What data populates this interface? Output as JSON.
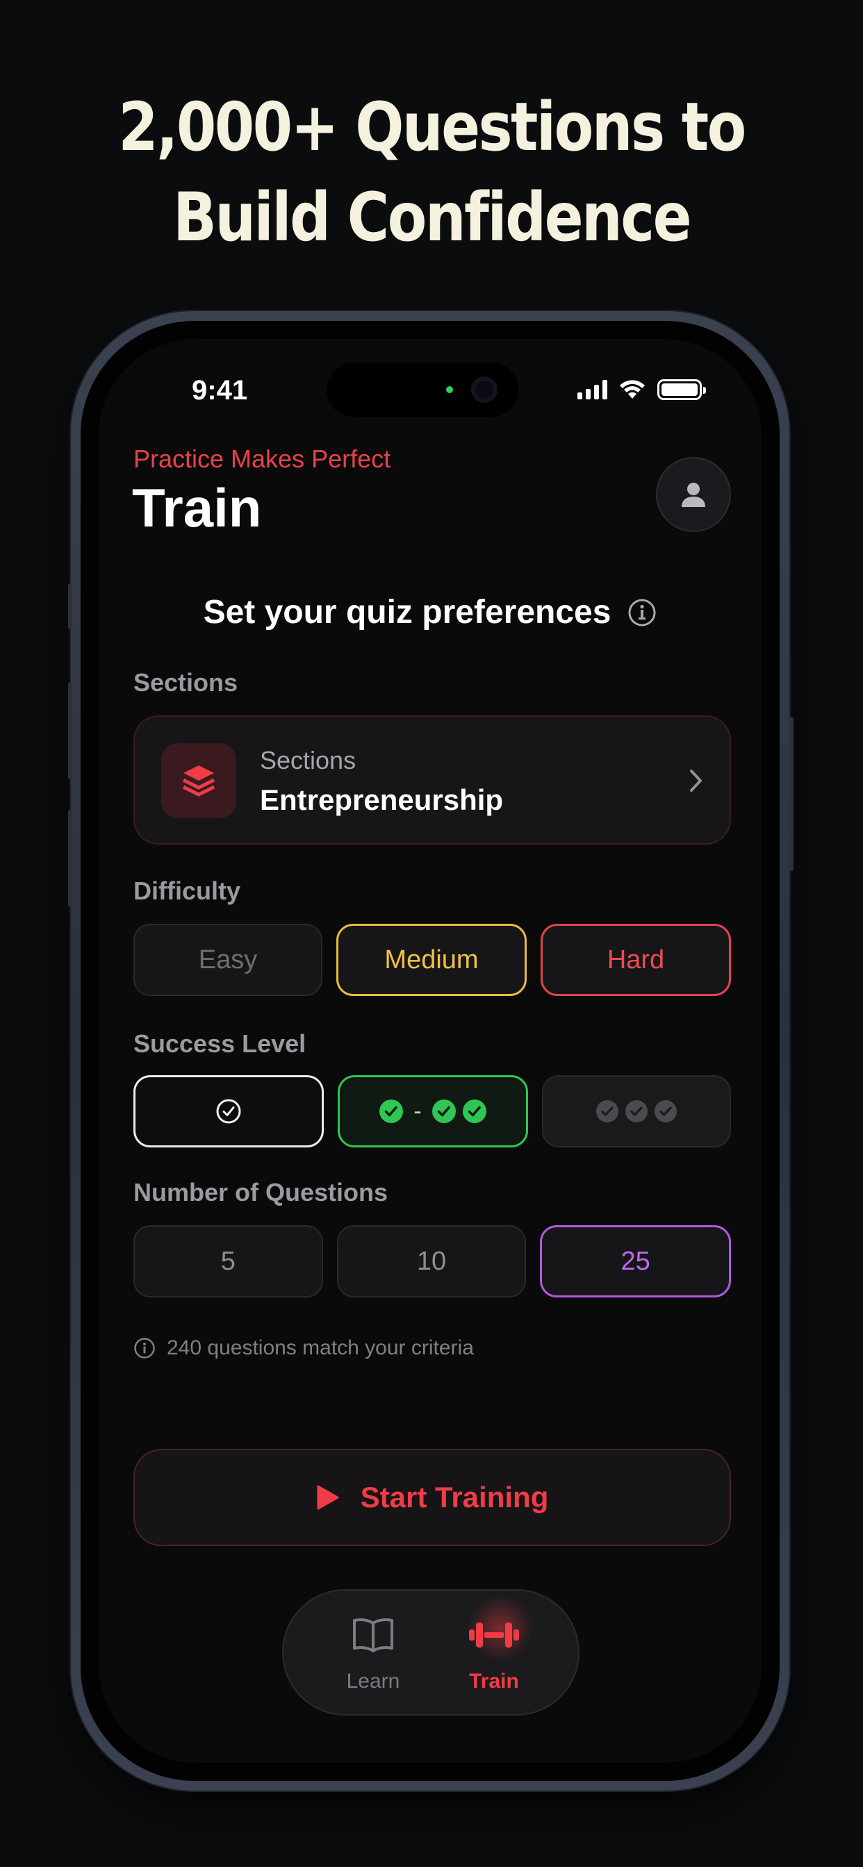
{
  "headline": {
    "line1": "2,000+ Questions to",
    "line2": "Build Confidence"
  },
  "status_bar": {
    "time": "9:41"
  },
  "header": {
    "eyebrow": "Practice Makes Perfect",
    "title": "Train",
    "profile_icon": "person-icon"
  },
  "preferences": {
    "heading": "Set your quiz preferences",
    "info_icon": "info-circle-icon"
  },
  "sections": {
    "label": "Sections",
    "card_subtitle": "Sections",
    "selected": "Entrepreneurship",
    "icon": "layers-icon"
  },
  "difficulty": {
    "label": "Difficulty",
    "options": [
      "Easy",
      "Medium",
      "Hard"
    ],
    "selected": [
      "Medium",
      "Hard"
    ]
  },
  "success_level": {
    "label": "Success Level",
    "options": [
      "check-circle-outline",
      "check-green-range",
      "check-gray-three"
    ],
    "dash": "-"
  },
  "questions": {
    "label": "Number of Questions",
    "options": [
      "5",
      "10",
      "25"
    ],
    "selected": "25"
  },
  "criteria_text": "240 questions match your criteria",
  "start_button": "Start Training",
  "tabbar": {
    "learn": "Learn",
    "train": "Train",
    "active": "Train"
  },
  "colors": {
    "accent_red": "#ef3c47",
    "medium_yellow": "#f2c23e",
    "success_green": "#2fc653",
    "purple": "#c067ef",
    "headline": "#f4f1df",
    "background": "#0a0a0b"
  }
}
